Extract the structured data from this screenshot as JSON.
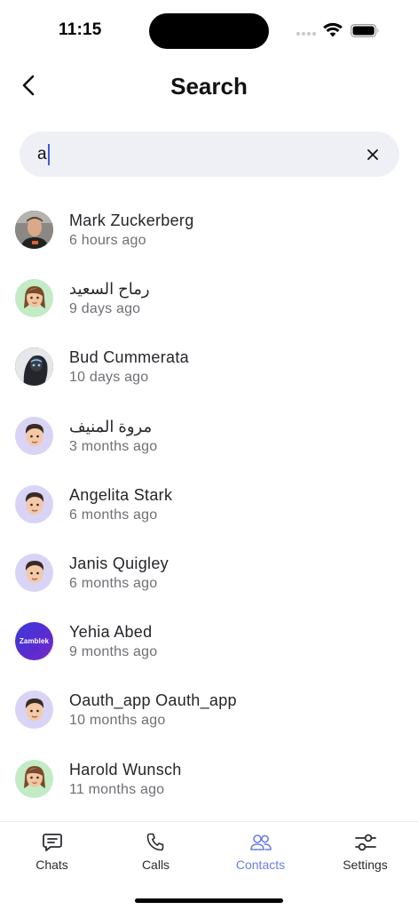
{
  "status_bar": {
    "time": "11:15"
  },
  "header": {
    "title": "Search"
  },
  "search": {
    "value": "a"
  },
  "results": [
    {
      "name": "Mark Zuckerberg",
      "last_seen": "6 hours ago",
      "avatar": "photo"
    },
    {
      "name": "رماح السعيد",
      "last_seen": "9 days ago",
      "avatar": "memoji-female"
    },
    {
      "name": "Bud Cummerata",
      "last_seen": "10 days ago",
      "avatar": "dark-photo"
    },
    {
      "name": "مروة المنيف",
      "last_seen": "3 months ago",
      "avatar": "memoji-male"
    },
    {
      "name": "Angelita Stark",
      "last_seen": "6 months ago",
      "avatar": "memoji-male"
    },
    {
      "name": "Janis Quigley",
      "last_seen": "6 months ago",
      "avatar": "memoji-male"
    },
    {
      "name": "Yehia Abed",
      "last_seen": "9 months ago",
      "avatar": "brand-logo",
      "avatar_text": "Zamblek"
    },
    {
      "name": "Oauth_app Oauth_app",
      "last_seen": "10 months ago",
      "avatar": "memoji-male"
    },
    {
      "name": "Harold Wunsch",
      "last_seen": "11 months ago",
      "avatar": "memoji-female"
    }
  ],
  "tabs": [
    {
      "label": "Chats",
      "icon": "chat-bubble-icon",
      "active": false
    },
    {
      "label": "Calls",
      "icon": "phone-icon",
      "active": false
    },
    {
      "label": "Contacts",
      "icon": "contacts-icon",
      "active": true
    },
    {
      "label": "Settings",
      "icon": "sliders-icon",
      "active": false
    }
  ],
  "colors": {
    "accent": "#6b7ee8",
    "search_bg": "#eff0f5",
    "memoji_green_bg": "#c3ebc6",
    "memoji_lavender_bg": "#d9d3f5"
  }
}
